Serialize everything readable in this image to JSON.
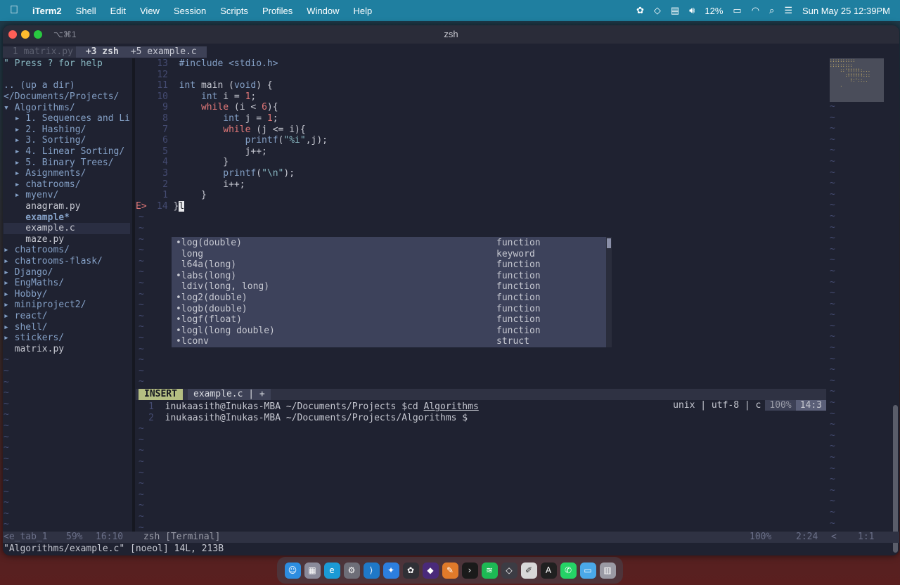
{
  "menubar": {
    "apple_icon": "",
    "app_name": "iTerm2",
    "items": [
      "Shell",
      "Edit",
      "View",
      "Session",
      "Scripts",
      "Profiles",
      "Window",
      "Help"
    ],
    "battery": "12%",
    "datetime": "Sun May 25  12:39PM"
  },
  "window": {
    "shortcut": "⌥⌘1",
    "title": "zsh"
  },
  "tabline": {
    "tab1": " 1 matrix.py ",
    "tab2": " +3 zsh ",
    "tab3": " +5 example.c "
  },
  "tree": {
    "help": "\" Press ? for help",
    "up": ".. (up a dir)",
    "root": "</Documents/Projects/",
    "lines": [
      {
        "t": "▾ Algorithms/",
        "c": "tree-dir"
      },
      {
        "t": "  ▸ 1. Sequences and Li",
        "c": "tree-dir"
      },
      {
        "t": "  ▸ 2. Hashing/",
        "c": "tree-dir"
      },
      {
        "t": "  ▸ 3. Sorting/",
        "c": "tree-dir"
      },
      {
        "t": "  ▸ 4. Linear Sorting/",
        "c": "tree-dir"
      },
      {
        "t": "  ▸ 5. Binary Trees/",
        "c": "tree-dir"
      },
      {
        "t": "  ▸ Asignments/",
        "c": "tree-dir"
      },
      {
        "t": "  ▸ chatrooms/",
        "c": "tree-dir"
      },
      {
        "t": "  ▸ myenv/",
        "c": "tree-dir"
      },
      {
        "t": "    anagram.py",
        "c": "tree-file"
      },
      {
        "t": "    example*",
        "c": "tree-mod"
      },
      {
        "t": "    example.c",
        "c": "tree-file tree-sel"
      },
      {
        "t": "    maze.py",
        "c": "tree-file"
      },
      {
        "t": "▸ chatrooms/",
        "c": "tree-dir"
      },
      {
        "t": "▸ chatrooms-flask/",
        "c": "tree-dir"
      },
      {
        "t": "▸ Django/",
        "c": "tree-dir"
      },
      {
        "t": "▸ EngMaths/",
        "c": "tree-dir"
      },
      {
        "t": "▸ Hobby/",
        "c": "tree-dir"
      },
      {
        "t": "▸ miniproject2/",
        "c": "tree-dir"
      },
      {
        "t": "▸ react/",
        "c": "tree-dir"
      },
      {
        "t": "▸ shell/",
        "c": "tree-dir"
      },
      {
        "t": "▸ stickers/",
        "c": "tree-dir"
      },
      {
        "t": "  matrix.py",
        "c": "tree-file"
      }
    ],
    "tilde": "~"
  },
  "editor": {
    "lines": [
      {
        "n": "13",
        "code": [
          [
            "#include <stdio.h>",
            "kw"
          ]
        ]
      },
      {
        "n": "12",
        "code": []
      },
      {
        "n": "11",
        "code": [
          [
            "int",
            "kw"
          ],
          [
            " main (",
            ""
          ],
          [
            "void",
            "kw"
          ],
          [
            ") {",
            ""
          ]
        ]
      },
      {
        "n": "10",
        "code": [
          [
            "    ",
            ""
          ],
          [
            "int",
            "kw"
          ],
          [
            " i = ",
            ""
          ],
          [
            "1",
            "num"
          ],
          [
            ";",
            ""
          ]
        ]
      },
      {
        "n": "9",
        "code": [
          [
            "    ",
            ""
          ],
          [
            "while",
            "num"
          ],
          [
            " (i < ",
            ""
          ],
          [
            "6",
            "num"
          ],
          [
            "){",
            ""
          ]
        ]
      },
      {
        "n": "8",
        "code": [
          [
            "        ",
            ""
          ],
          [
            "int",
            "kw"
          ],
          [
            " j = ",
            ""
          ],
          [
            "1",
            "num"
          ],
          [
            ";",
            ""
          ]
        ]
      },
      {
        "n": "7",
        "code": [
          [
            "        ",
            ""
          ],
          [
            "while",
            "num"
          ],
          [
            " (j <= i){",
            ""
          ]
        ]
      },
      {
        "n": "6",
        "code": [
          [
            "            ",
            ""
          ],
          [
            "printf",
            "kw"
          ],
          [
            "(",
            ""
          ],
          [
            "\"%i\"",
            "str"
          ],
          [
            ",j);",
            ""
          ]
        ]
      },
      {
        "n": "5",
        "code": [
          [
            "            j++;",
            ""
          ]
        ]
      },
      {
        "n": "4",
        "code": [
          [
            "        }",
            ""
          ]
        ]
      },
      {
        "n": "3",
        "code": [
          [
            "        ",
            ""
          ],
          [
            "printf",
            "kw"
          ],
          [
            "(",
            ""
          ],
          [
            "\"\\n\"",
            "str"
          ],
          [
            ");",
            ""
          ]
        ]
      },
      {
        "n": "2",
        "code": [
          [
            "        i++;",
            ""
          ]
        ]
      },
      {
        "n": "1",
        "code": [
          [
            "    }",
            ""
          ]
        ]
      }
    ],
    "current": {
      "err": "E>",
      "n": "14",
      "code": " }l",
      "cursor": "l"
    }
  },
  "completion": [
    {
      "word": "•log(double)",
      "kind": "function"
    },
    {
      "word": " long",
      "kind": "keyword"
    },
    {
      "word": " l64a(long)",
      "kind": "function"
    },
    {
      "word": "•labs(long)",
      "kind": "function"
    },
    {
      "word": " ldiv(long, long)",
      "kind": "function"
    },
    {
      "word": "•log2(double)",
      "kind": "function"
    },
    {
      "word": "•logb(double)",
      "kind": "function"
    },
    {
      "word": "•logf(float)",
      "kind": "function"
    },
    {
      "word": "•logl(long double)",
      "kind": "function"
    },
    {
      "word": "•lconv",
      "kind": "struct"
    }
  ],
  "statusline": {
    "mode": "INSERT",
    "file": "example.c | +",
    "info": "unix | utf-8 | c",
    "percent": "100%",
    "pos": "14:3"
  },
  "terminal": {
    "lines": [
      {
        "n": "1",
        "prompt": "inukaasith@Inukas-MBA ~/Documents/Projects $cd ",
        "arg": "Algorithms"
      },
      {
        "n": "2",
        "prompt": "inukaasith@Inukas-MBA ~/Documents/Projects/Algorithms $",
        "arg": ""
      }
    ]
  },
  "bottombar": {
    "tree_name": "<e_tab_1",
    "tree_pct": "59%",
    "tree_pos": "16:10",
    "term_name": " zsh [Terminal]",
    "term_pct": "100%",
    "term_pos": "2:24",
    "mini_name": "<",
    "mini_pos": "1:1"
  },
  "cmdline": "\"Algorithms/example.c\" [noeol] 14L, 213B",
  "minimap_text": "::::::::::\n:::::::::\n    ::'!!!!!:...\n      :!!!!!!:::\n        !:'::..\n    .",
  "dock": [
    {
      "name": "finder-icon",
      "color": "#2d8de0",
      "glyph": "☺"
    },
    {
      "name": "launchpad-icon",
      "color": "#8a8a9a",
      "glyph": "▦"
    },
    {
      "name": "edge-icon",
      "color": "#1b9ad6",
      "glyph": "e"
    },
    {
      "name": "settings-icon",
      "color": "#6e6e78",
      "glyph": "⚙"
    },
    {
      "name": "vscode-icon",
      "color": "#1f78c8",
      "glyph": "⟩"
    },
    {
      "name": "safari-icon",
      "color": "#2c7fe0",
      "glyph": "✦"
    },
    {
      "name": "chatgpt-icon",
      "color": "#303036",
      "glyph": "✿"
    },
    {
      "name": "obsidian-icon",
      "color": "#4a2a7a",
      "glyph": "◆"
    },
    {
      "name": "pages-icon",
      "color": "#e07a2a",
      "glyph": "✎"
    },
    {
      "name": "terminal-icon",
      "color": "#1a1a1a",
      "glyph": "›"
    },
    {
      "name": "spotify-icon",
      "color": "#1db954",
      "glyph": "≋"
    },
    {
      "name": "notes-icon",
      "color": "#3c3c44",
      "glyph": "◇"
    },
    {
      "name": "textedit-icon",
      "color": "#d8d8d8",
      "glyph": "✐"
    },
    {
      "name": "dictionary-icon",
      "color": "#202020",
      "glyph": "A"
    },
    {
      "name": "whatsapp-icon",
      "color": "#25d366",
      "glyph": "✆"
    },
    {
      "name": "folder-icon",
      "color": "#4aa8e8",
      "glyph": "▭"
    },
    {
      "name": "trash-icon",
      "color": "#9a9aa4",
      "glyph": "▥"
    }
  ]
}
